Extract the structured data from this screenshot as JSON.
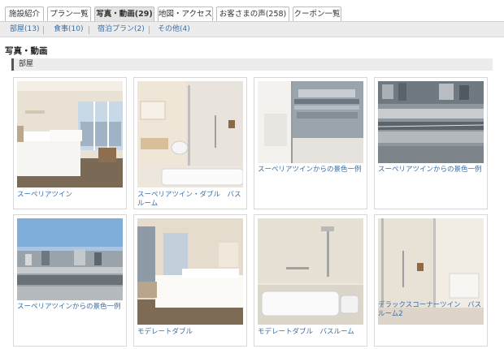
{
  "tabs": [
    {
      "label": "施設紹介"
    },
    {
      "label": "プラン一覧"
    },
    {
      "label": "写真・動画(29)"
    },
    {
      "label": "地図・アクセス"
    },
    {
      "label": "お客さまの声(258)"
    },
    {
      "label": "クーポン一覧"
    }
  ],
  "subnav": [
    {
      "label": "部屋(13)"
    },
    {
      "label": "食事(10)"
    },
    {
      "label": "宿泊プラン(2)"
    },
    {
      "label": "その他(4)"
    }
  ],
  "section": {
    "title": "写真・動画",
    "category": "部屋"
  },
  "photos": [
    {
      "caption": "スーペリアツイン"
    },
    {
      "caption": "スーペリアツイン・ダブル　バスルーム"
    },
    {
      "caption": "スーペリアツインからの景色一例"
    },
    {
      "caption": "スーペリアツインからの景色一例"
    },
    {
      "caption": "スーペリアツインからの景色一例"
    },
    {
      "caption": "モデレートダブル"
    },
    {
      "caption": "モデレートダブル　バスルーム"
    },
    {
      "caption": "デラックスコーナーツイン　バスルーム2"
    }
  ]
}
